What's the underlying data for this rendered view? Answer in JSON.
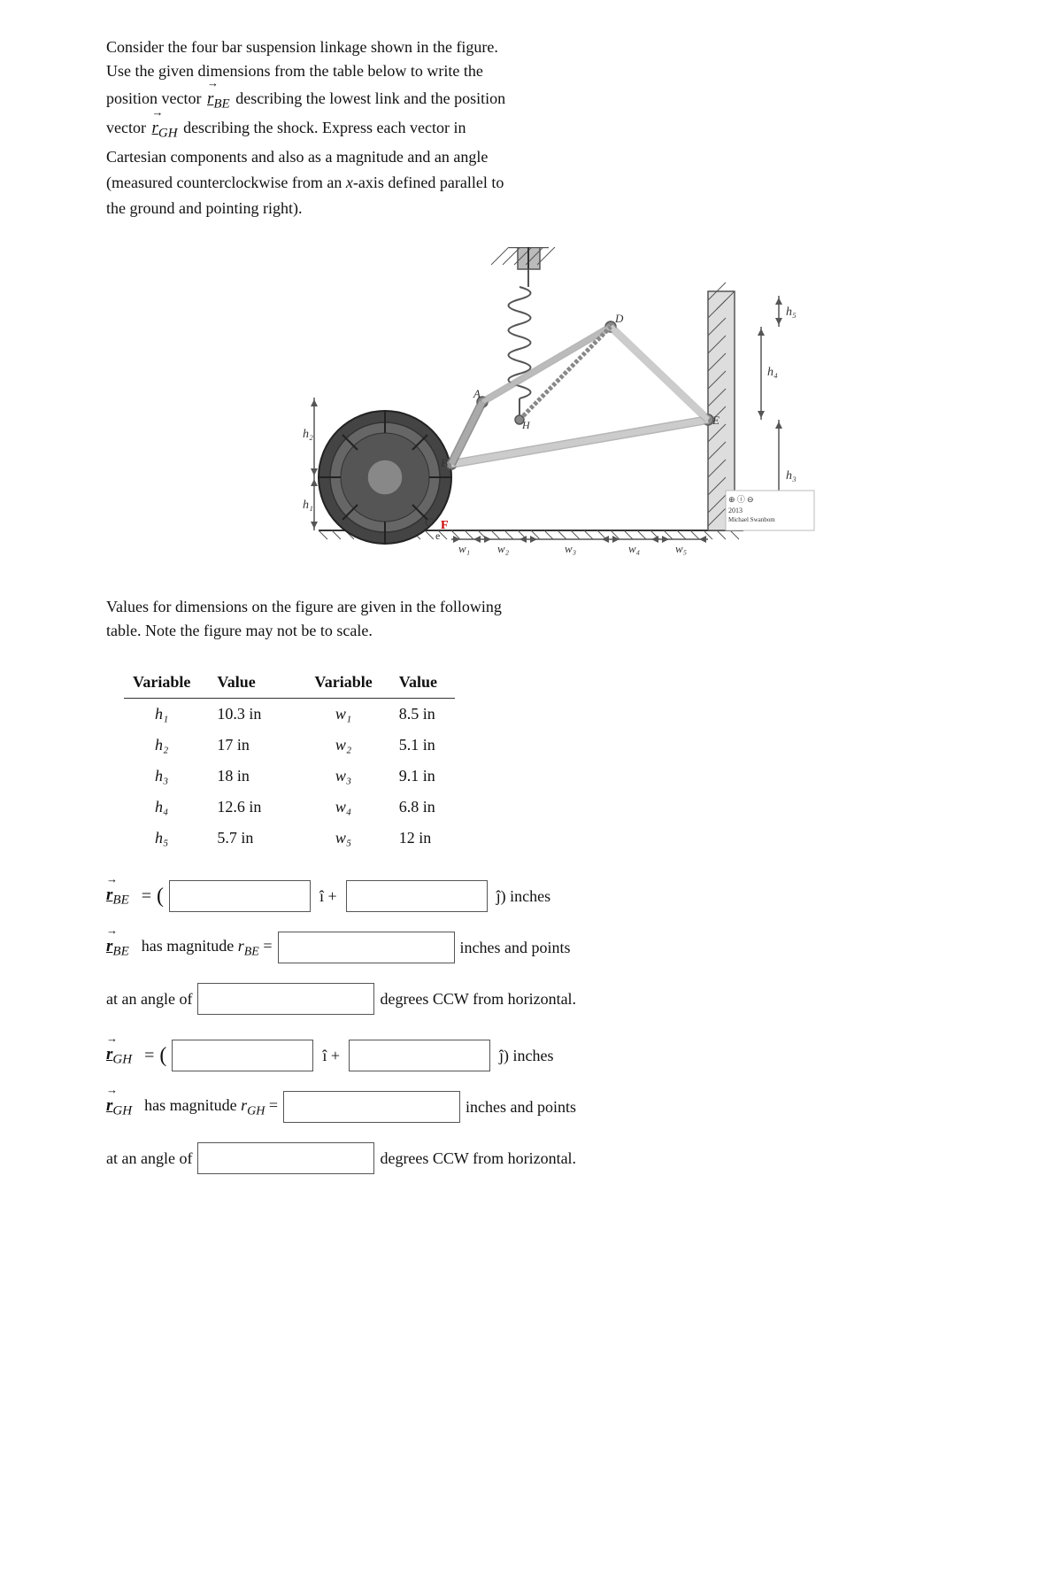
{
  "problem": {
    "intro_line1": "Consider the four bar suspension linkage shown in the figure.",
    "intro_line2": "Use the given dimensions from the table below to write the",
    "intro_line3_pre": "position vector ",
    "vec_rBE_label": "r",
    "vec_rBE_sub": "BE",
    "intro_line3_post": " describing the lowest link and the position",
    "intro_line4_pre": "vector ",
    "vec_rGH_label": "r",
    "vec_rGH_sub": "GH",
    "intro_line4_post": " describing the shock. Express each vector in",
    "intro_line5": "Cartesian components and also as a magnitude and an angle",
    "intro_line6_pre": "(measured counterclockwise from an ",
    "xaxis": "x",
    "intro_line6_post": "-axis defined parallel to",
    "intro_line7": "the ground and pointing right)."
  },
  "table": {
    "note_line1": "Values for dimensions on the figure are given in the following",
    "note_line2": "table. Note the figure may not be to scale.",
    "col1_header": "Variable",
    "col2_header": "Value",
    "col3_header": "Variable",
    "col4_header": "Value",
    "rows": [
      {
        "var1": "h₁",
        "val1": "10.3 in",
        "var2": "w₁",
        "val2": "8.5 in"
      },
      {
        "var1": "h₂",
        "val1": "17 in",
        "var2": "w₂",
        "val2": "5.1 in"
      },
      {
        "var1": "h₃",
        "val1": "18 in",
        "var2": "w₃",
        "val2": "9.1 in"
      },
      {
        "var1": "h₄",
        "val1": "12.6 in",
        "var2": "w₄",
        "val2": "6.8 in"
      },
      {
        "var1": "h₅",
        "val1": "5.7 in",
        "var2": "w₅",
        "val2": "12 in"
      }
    ]
  },
  "answer_blocks": {
    "rBE_label": "r",
    "rBE_sub": "BE",
    "rBE_equals": "= (",
    "rBE_i_hat": "î",
    "rBE_plus": "+",
    "rBE_j_hat": "ĵ",
    "rBE_units": ") inches",
    "rBE_mag_pre": "has magnitude r",
    "rBE_mag_sub": "BE",
    "rBE_mag_equals": "=",
    "rBE_mag_units": "inches and points",
    "rBE_angle_pre": "at an angle of",
    "rBE_angle_units": "degrees CCW from horizontal.",
    "rGH_label": "r",
    "rGH_sub": "GH",
    "rGH_equals": "= (",
    "rGH_i_hat": "î",
    "rGH_plus": "+",
    "rGH_j_hat": "ĵ",
    "rGH_units": ") inches",
    "rGH_mag_pre": "has magnitude r",
    "rGH_mag_sub": "GH",
    "rGH_mag_equals": "=",
    "rGH_mag_units": "inches and points",
    "rGH_angle_pre": "at an angle of",
    "rGH_angle_units": "degrees CCW from horizontal."
  },
  "colors": {
    "accent_blue": "#1a5fa8",
    "accent_red": "#cc0000",
    "gray_line": "#999",
    "dark_line": "#333"
  }
}
